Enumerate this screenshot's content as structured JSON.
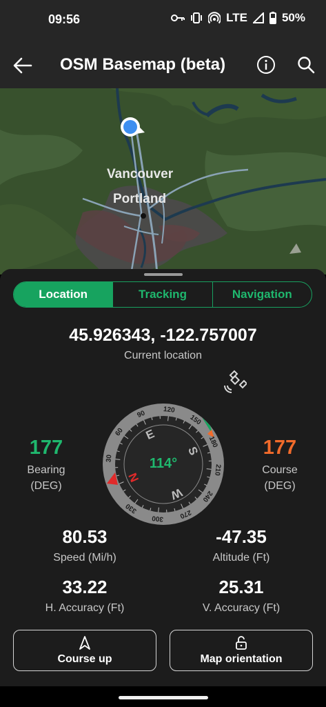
{
  "status_bar": {
    "time": "09:56",
    "network": "LTE",
    "battery": "50%"
  },
  "app_bar": {
    "title": "OSM Basemap (beta)",
    "icons": [
      "arrow-back-icon",
      "info-icon",
      "search-icon"
    ]
  },
  "map": {
    "labels": [
      "Vancouver",
      "Portland"
    ]
  },
  "tabs": [
    {
      "label": "Location",
      "active": true
    },
    {
      "label": "Tracking",
      "active": false
    },
    {
      "label": "Navigation",
      "active": false
    }
  ],
  "location": {
    "coordinates": "45.926343, -122.757007",
    "label": "Current location"
  },
  "compass": {
    "heading": "114°",
    "cardinals": [
      "E",
      "S",
      "W",
      "N"
    ],
    "ticks": [
      "30",
      "60",
      "90",
      "120",
      "150",
      "180",
      "210",
      "240",
      "270",
      "300",
      "330"
    ]
  },
  "bearing": {
    "value": "177",
    "label1": "Bearing",
    "label2": "(DEG)"
  },
  "course": {
    "value": "177",
    "label1": "Course",
    "label2": "(DEG)"
  },
  "speed": {
    "value": "80.53",
    "label": "Speed (Mi/h)"
  },
  "altitude": {
    "value": "-47.35",
    "label": "Altitude (Ft)"
  },
  "h_accuracy": {
    "value": "33.22",
    "label": "H. Accuracy (Ft)"
  },
  "v_accuracy": {
    "value": "25.31",
    "label": "V. Accuracy (Ft)"
  },
  "buttons": {
    "course_up": "Course up",
    "map_orientation": "Map orientation"
  },
  "colors": {
    "accent_green": "#17a35f",
    "bearing_green": "#1fb86e",
    "course_orange": "#f26b2b",
    "north_red": "#e02a2a"
  }
}
